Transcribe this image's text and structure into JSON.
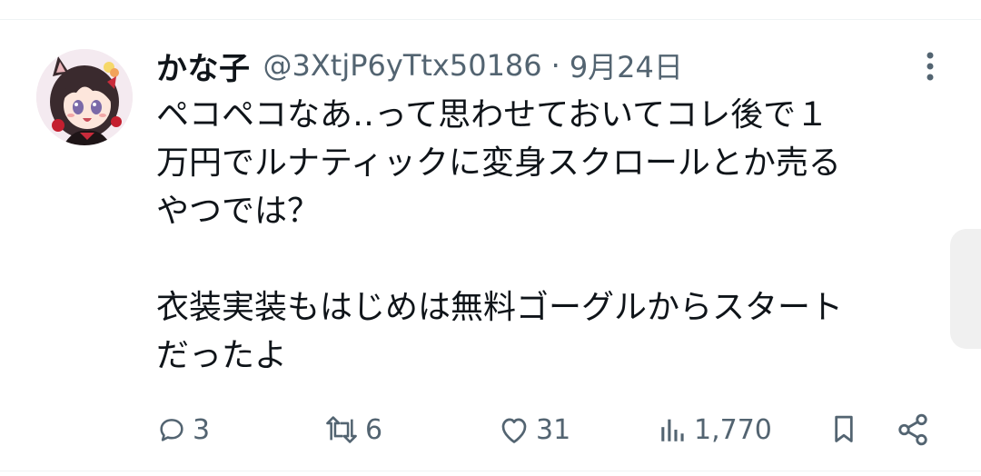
{
  "tweet": {
    "author": {
      "display_name": "かな子",
      "handle": "@3XtjP6yTtx50186",
      "avatar_icon": "anime-girl-avatar"
    },
    "separator": "·",
    "date": "9月24日",
    "body_lines": [
      "ペコペコなあ‥って思わせておいてコレ後で１",
      "万円でルナティックに変身スクロールとか売る",
      "やつでは？",
      "",
      "衣装実装もはじめは無料ゴーグルからスタート",
      "だったよ"
    ],
    "actions": {
      "reply_count": "3",
      "retweet_count": "6",
      "like_count": "31",
      "view_count": "1,770"
    },
    "colors": {
      "text": "#0f1419",
      "secondary": "#536471",
      "divider": "#eff3f4"
    }
  }
}
